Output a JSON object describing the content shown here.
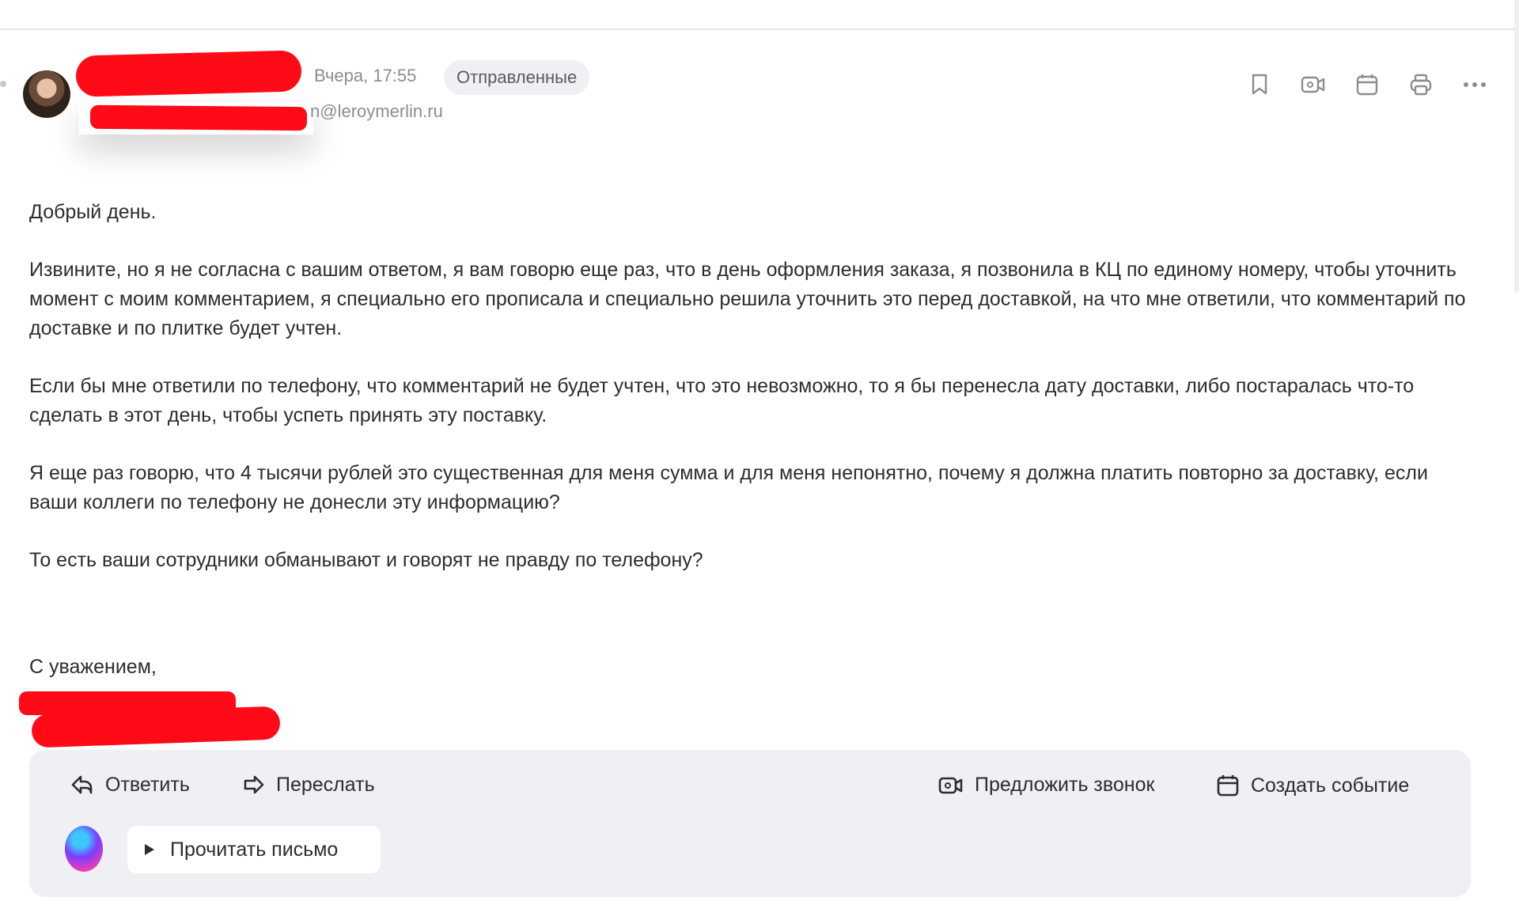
{
  "message": {
    "date": "Вчера, 17:55",
    "folder_badge": "Отправленные",
    "sender_email_visible": "n@leroymerlin.ru"
  },
  "toolbar": {
    "icons": [
      "bookmark-icon",
      "video-call-icon",
      "calendar-icon",
      "print-icon",
      "more-icon"
    ]
  },
  "body": {
    "greeting": "Добрый день.",
    "paragraphs": [
      "Извините, но я не согласна с вашим ответом, я вам говорю еще раз, что в день оформления заказа, я позвонила в КЦ по единому номеру, чтобы уточнить момент с моим комментарием, я специально его прописала и специально решила уточнить это перед доставкой, на что мне ответили, что комментарий по доставке и по плитке будет учтен.",
      "Если бы мне ответили по телефону, что комментарий не будет учтен, что это невозможно, то я бы перенесла дату доставки, либо постаралась что-то сделать в этот день, чтобы успеть принять эту поставку.",
      "Я еще раз говорю, что 4 тысячи рублей это существенная для меня сумма и для меня непонятно, почему я должна платить повторно за доставку, если ваши коллеги по телефону не донесли эту информацию?",
      "То есть ваши сотрудники обманывают и говорят не правду по телефону?"
    ],
    "signoff": "С уважением,"
  },
  "actions": {
    "reply": "Ответить",
    "forward": "Переслать",
    "propose_call": "Предложить звонок",
    "create_event": "Создать событие",
    "read_aloud": "Прочитать письмо"
  },
  "colors": {
    "redaction": "#ff0a16",
    "panel_bg": "#eef0f3",
    "text": "#2c2d2e",
    "muted": "#8c8d91"
  }
}
